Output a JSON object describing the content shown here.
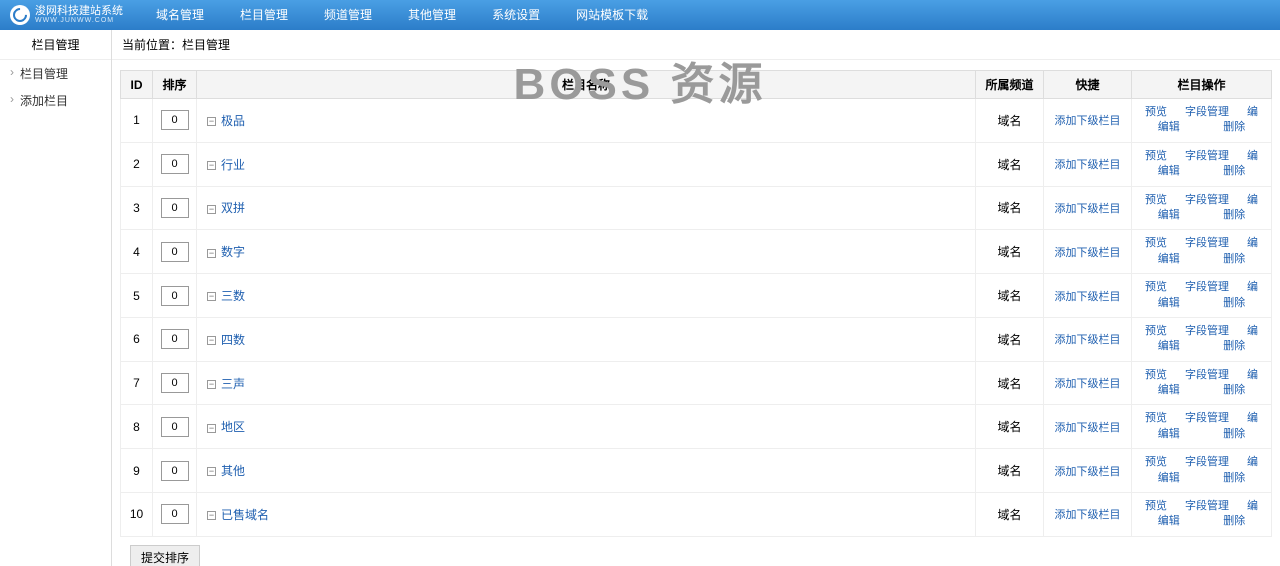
{
  "watermark": "BOSS 资源",
  "logo": {
    "title": "浚网科技建站系统",
    "sub": "WWW.JUNWW.COM"
  },
  "topNav": [
    "域名管理",
    "栏目管理",
    "频道管理",
    "其他管理",
    "系统设置",
    "网站模板下载"
  ],
  "sidebar": {
    "title": "栏目管理",
    "items": [
      "栏目管理",
      "添加栏目"
    ]
  },
  "breadcrumb": "当前位置：栏目管理",
  "table": {
    "headers": {
      "id": "ID",
      "sort": "排序",
      "name": "栏目名称",
      "channel": "所属频道",
      "quick": "快捷",
      "ops": "栏目操作"
    },
    "channelText": "域名",
    "quickText": "添加下级栏目",
    "ops": {
      "preview": "预览",
      "field": "字段管理",
      "edit": "编辑",
      "delete": "删除",
      "edit2": "编"
    },
    "rows": [
      {
        "id": "1",
        "sort": "0",
        "name": "极品"
      },
      {
        "id": "2",
        "sort": "0",
        "name": "行业"
      },
      {
        "id": "3",
        "sort": "0",
        "name": "双拼"
      },
      {
        "id": "4",
        "sort": "0",
        "name": "数字"
      },
      {
        "id": "5",
        "sort": "0",
        "name": "三数"
      },
      {
        "id": "6",
        "sort": "0",
        "name": "四数"
      },
      {
        "id": "7",
        "sort": "0",
        "name": "三声"
      },
      {
        "id": "8",
        "sort": "0",
        "name": "地区"
      },
      {
        "id": "9",
        "sort": "0",
        "name": "其他"
      },
      {
        "id": "10",
        "sort": "0",
        "name": "已售域名"
      }
    ]
  },
  "submitSort": "提交排序"
}
